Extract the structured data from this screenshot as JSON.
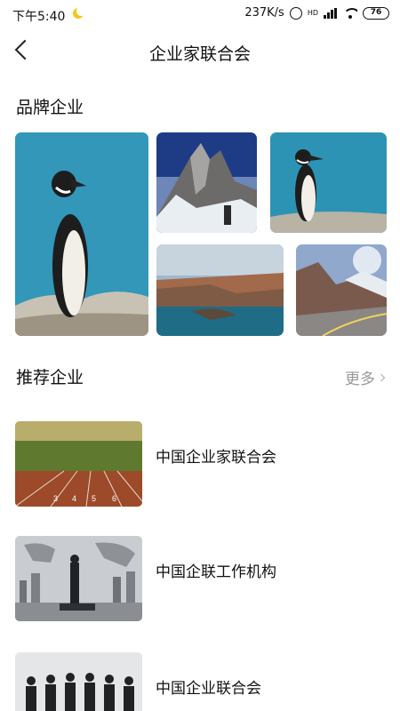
{
  "status_bar": {
    "time": "下午5:40",
    "network_speed": "237K/s",
    "hd_label": "HD",
    "battery": "76"
  },
  "header": {
    "title": "企业家联合会"
  },
  "brand_section": {
    "title": "品牌企业"
  },
  "recommend_section": {
    "title": "推荐企业",
    "more_label": "更多",
    "items": [
      {
        "name": "中国企业家联合会"
      },
      {
        "name": "中国企联工作机构"
      },
      {
        "name": "中国企业联合会"
      }
    ],
    "track_numbers": [
      "3",
      "4",
      "5",
      "6"
    ]
  }
}
